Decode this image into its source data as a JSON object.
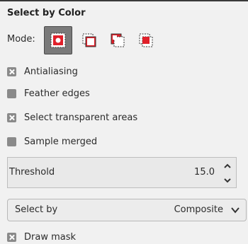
{
  "panel": {
    "title": "Select by Color",
    "mode_label": "Mode:",
    "mode_icons": [
      "replace-selection-icon",
      "add-selection-icon",
      "subtract-selection-icon",
      "intersect-selection-icon"
    ],
    "options": {
      "antialiasing": "Antialiasing",
      "feather_edges": "Feather edges",
      "select_transparent": "Select transparent areas",
      "sample_merged": "Sample merged",
      "draw_mask": "Draw mask"
    },
    "threshold": {
      "label": "Threshold",
      "value": "15.0"
    },
    "select_by": {
      "label": "Select by",
      "value": "Composite"
    }
  },
  "colors": {
    "accent": "#e0202a",
    "active_mode_bg": "#7a7a7a",
    "panel_bg": "#f1f1f1",
    "checkbox": "#8a8a8a"
  }
}
